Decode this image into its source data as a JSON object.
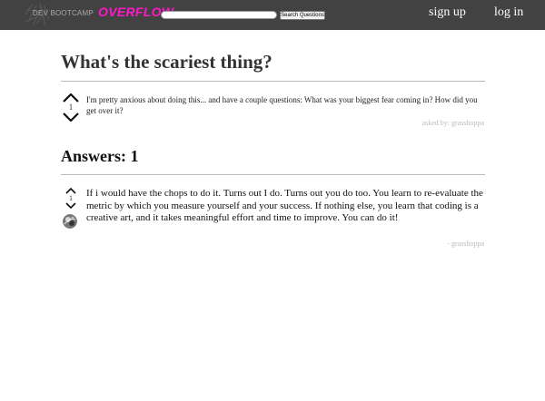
{
  "header": {
    "logo_dev_text": "DEV BOOTCAMP",
    "logo_overflow_text": "OVERFLOW",
    "search_placeholder": "",
    "search_button_label": "Search Questions",
    "nav_signup_label": "sign up",
    "nav_login_label": "log in",
    "colors": {
      "header_bg": "#424242",
      "logo_accent": "#ff18c8",
      "nav_text": "#ffffff"
    }
  },
  "question": {
    "title": "What's the scariest thing?",
    "votes": "1",
    "body": "I'm pretty anxious about doing this... and have a couple questions: What was your biggest fear coming in? How did you get over it?",
    "meta": "asked by: grasshoppa",
    "up_icon": "chevron-up-icon",
    "down_icon": "chevron-down-icon"
  },
  "answers": {
    "heading": "Answers: 1",
    "items": [
      {
        "votes": "1",
        "body": "If i would have the chops to do it. Turns out I do. Turns out you do too. You learn to re-evaluate the metric by which you measure yourself and your success. If nothing else, you learn that coding is a creative art, and it takes meaningful effort and time to improve. You can do it!",
        "author": "- grasshoppa",
        "avatar_icon": "avatar-icon"
      }
    ]
  }
}
